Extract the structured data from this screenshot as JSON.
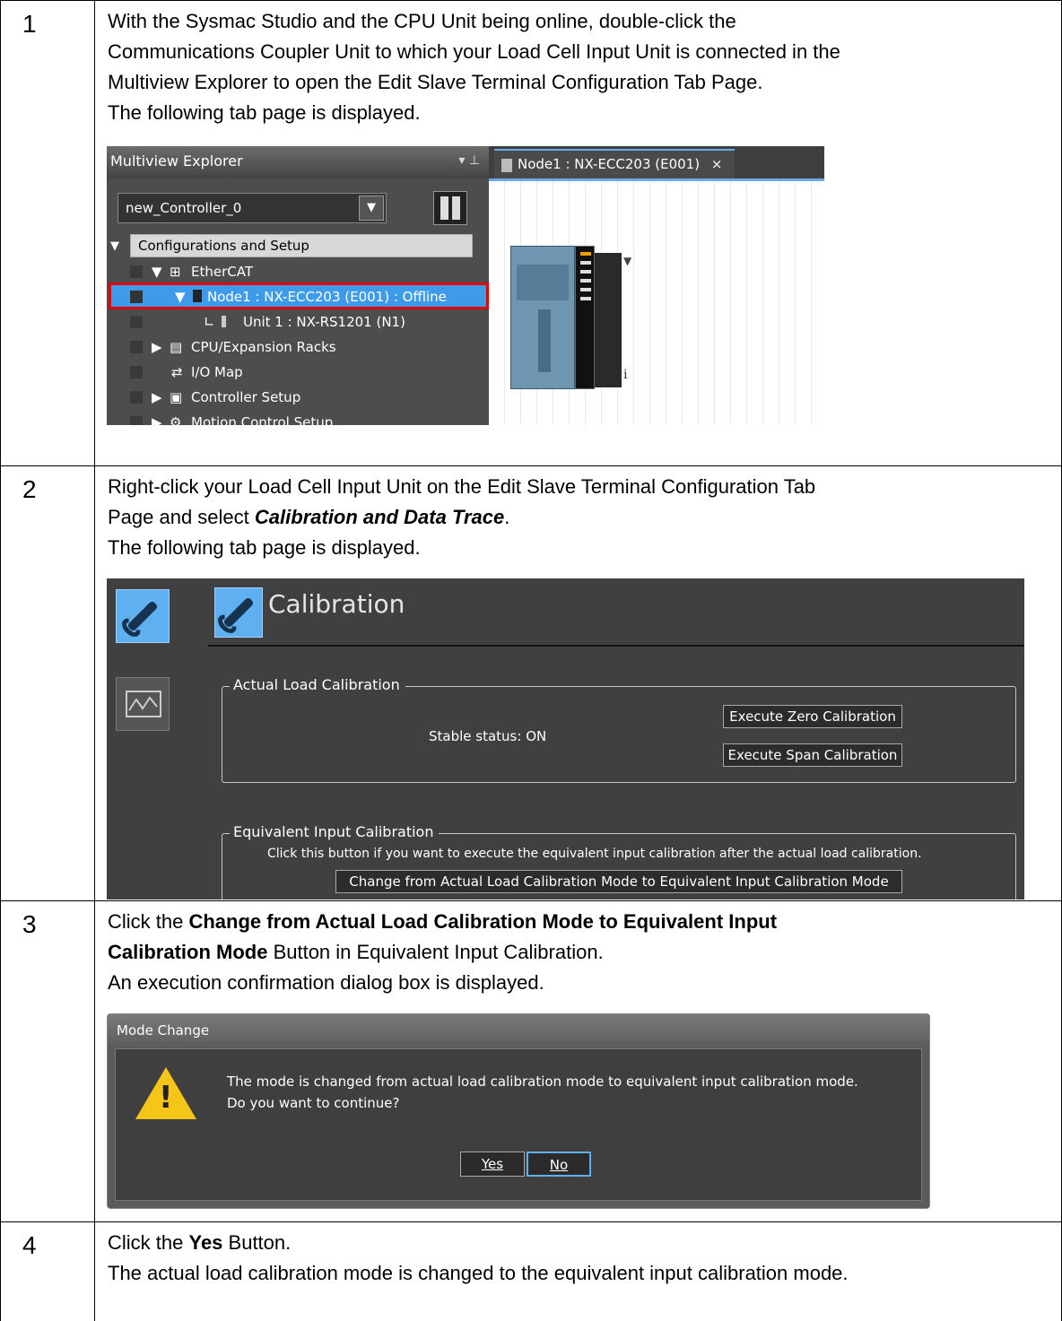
{
  "steps": [
    {
      "num": "1",
      "lines": [
        "With the Sysmac Studio and the CPU Unit being online, double-click the",
        "Communications Coupler Unit to which your Load Cell Input Unit is connected in the",
        "Multiview Explorer to open the Edit Slave Terminal Configuration Tab Page.",
        "The following tab page is displayed."
      ]
    },
    {
      "num": "2",
      "line1": "Right-click your Load Cell Input Unit on the Edit Slave Terminal Configuration Tab",
      "line2_pre": "Page and select ",
      "line2_em": "Calibration and Data Trace",
      "line2_post": ".",
      "line3": "The following tab page is displayed."
    },
    {
      "num": "3",
      "line1_pre": "Click the ",
      "line1_b": "Change from Actual Load Calibration Mode to Equivalent Input",
      "line2_b": "Calibration Mode",
      "line2_post": " Button in Equivalent Input Calibration.",
      "line3": "An execution confirmation dialog box is displayed."
    },
    {
      "num": "4",
      "line1_pre": "Click the ",
      "line1_b": "Yes",
      "line1_post": " Button.",
      "line2": "The actual load calibration mode is changed to the equivalent input calibration mode."
    }
  ],
  "explorer": {
    "title": "Multiview Explorer",
    "pin": "▾ ⊥",
    "controller": "new_Controller_0",
    "tree": [
      "Configurations and Setup",
      "EtherCAT",
      "Node1 : NX-ECC203 (E001) : Offline",
      "Unit 1 : NX-RS1201 (N1)",
      "CPU/Expansion Racks",
      "I/O Map",
      "Controller Setup",
      "Motion Control Setup"
    ],
    "tab": "Node1 : NX-ECC203 (E001)",
    "tab_close": "×",
    "info": "i"
  },
  "calibration": {
    "title": "Calibration",
    "actual_legend": "Actual Load Calibration",
    "stable": "Stable status: ON",
    "zero_btn": "Execute Zero Calibration",
    "span_btn": "Execute Span Calibration",
    "equiv_legend": "Equivalent Input Calibration",
    "equiv_text": "Click this button if you want to execute the equivalent input calibration after the actual load calibration.",
    "change_btn": "Change from Actual Load Calibration Mode to Equivalent Input Calibration Mode"
  },
  "dialog": {
    "title": "Mode Change",
    "line1": "The mode is changed from actual load calibration mode to equivalent input calibration mode.",
    "line2": "Do you want to continue?",
    "yes": "Yes",
    "no": "No"
  },
  "colors": {
    "selection_blue": "#3d9be9",
    "highlight_red": "#e00000",
    "warning_yellow": "#f5c518"
  }
}
